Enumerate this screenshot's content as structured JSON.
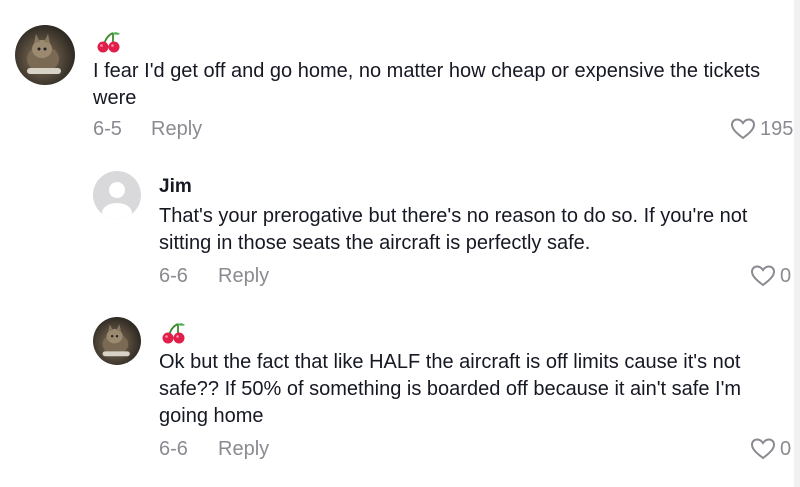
{
  "comments": [
    {
      "author": "",
      "author_emoji": "cherries",
      "avatar": "cat-avatar",
      "text": "I fear I'd get off and go home, no matter how cheap or expensive the tickets were",
      "date": "6-5",
      "reply_label": "Reply",
      "likes": "195"
    },
    {
      "author": "Jim",
      "avatar": "default-avatar",
      "text": "That's your prerogative but there's no reason to do so. If you're not sitting in those seats the aircraft is perfectly safe.",
      "date": "6-6",
      "reply_label": "Reply",
      "likes": "0"
    },
    {
      "author": "",
      "author_emoji": "cherries",
      "avatar": "cat-avatar",
      "text": "Ok but the fact that like HALF the aircraft is off limits cause it's not safe?? If 50% of something is boarded off because it ain't safe I'm going home",
      "date": "6-6",
      "reply_label": "Reply",
      "likes": "0"
    }
  ],
  "colors": {
    "text": "#161823",
    "muted": "#8a8b91",
    "cherry": "#e0204a"
  }
}
